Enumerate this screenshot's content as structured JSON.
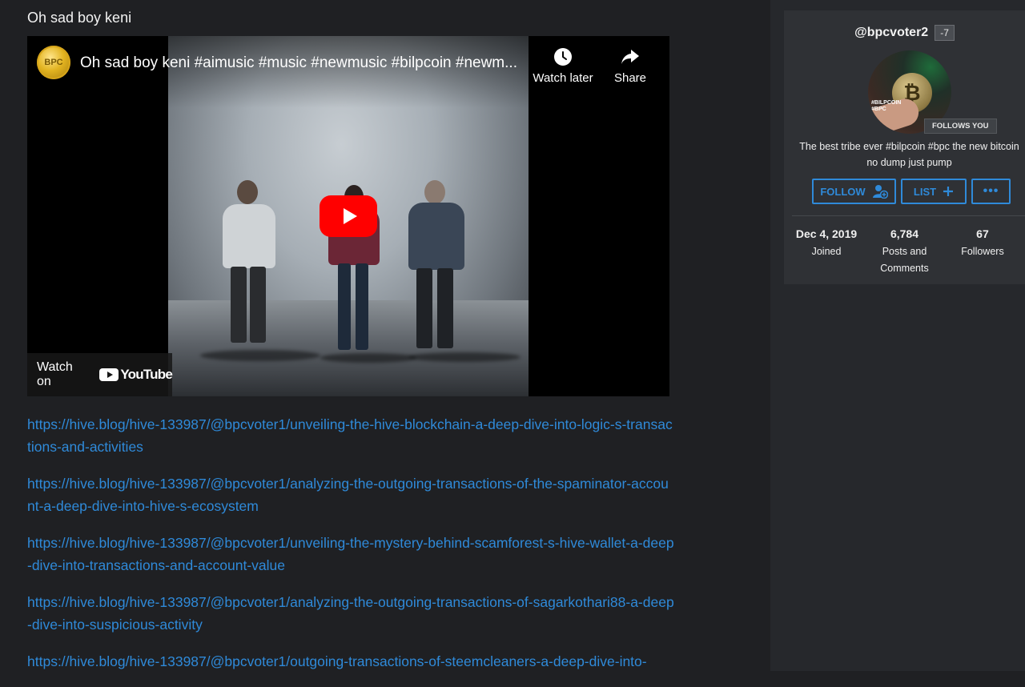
{
  "post": {
    "title": "Oh sad boy keni"
  },
  "video": {
    "channel_logo_text": "BPC",
    "title": "Oh sad boy keni #aimusic #music #newmusic #bilpcoin #newm...",
    "watch_later_label": "Watch later",
    "share_label": "Share",
    "watch_on_label": "Watch on",
    "youtube_brand": "YouTube"
  },
  "links": [
    "https://hive.blog/hive-133987/@bpcvoter1/unveiling-the-hive-blockchain-a-deep-dive-into-logic-s-transactions-and-activities",
    "https://hive.blog/hive-133987/@bpcvoter1/analyzing-the-outgoing-transactions-of-the-spaminator-account-a-deep-dive-into-hive-s-ecosystem",
    "https://hive.blog/hive-133987/@bpcvoter1/unveiling-the-mystery-behind-scamforest-s-hive-wallet-a-deep-dive-into-transactions-and-account-value",
    "https://hive.blog/hive-133987/@bpcvoter1/analyzing-the-outgoing-transactions-of-sagarkothari88-a-deep-dive-into-suspicious-activity",
    "https://hive.blog/hive-133987/@bpcvoter1/outgoing-transactions-of-steemcleaners-a-deep-dive-into-"
  ],
  "profile": {
    "username": "@bpcvoter2",
    "reputation": "-7",
    "avatar_tag": "#BILPCOIN #BPC",
    "follows_you": "FOLLOWS YOU",
    "bio": "The best tribe ever #bilpcoin #bpc the new bitcoin no dump just pump",
    "follow_label": "FOLLOW",
    "list_label": "LIST",
    "more_label": "•••",
    "stats": [
      {
        "value": "Dec 4, 2019",
        "label": "Joined"
      },
      {
        "value": "6,784",
        "label": "Posts and Comments"
      },
      {
        "value": "67",
        "label": "Followers"
      }
    ]
  },
  "colors": {
    "link": "#2f8ad9",
    "youtube_red": "#ff0000",
    "background": "#1f2023",
    "card": "#2f3135"
  }
}
